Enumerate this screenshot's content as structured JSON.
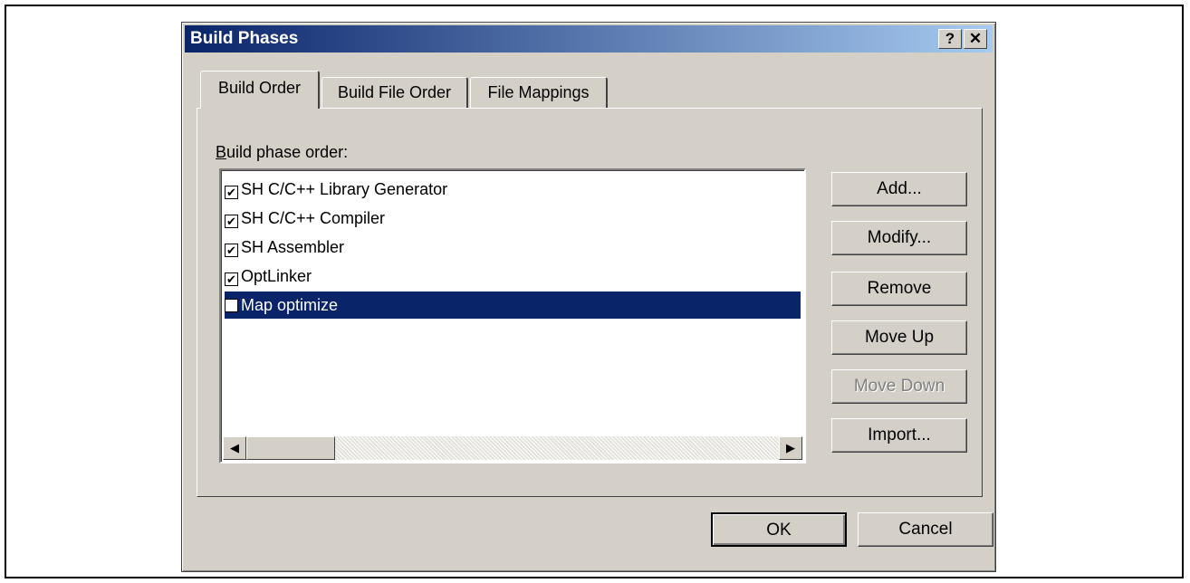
{
  "dialog": {
    "title": "Build Phases",
    "help_button": "?",
    "close_button": "✕"
  },
  "tabs": [
    {
      "label": "Build Order",
      "active": true
    },
    {
      "label": "Build File Order",
      "active": false
    },
    {
      "label": "File Mappings",
      "active": false
    }
  ],
  "panel": {
    "list_label": "Build phase order:",
    "items": [
      {
        "label": "SH C/C++ Library Generator",
        "checked": true
      },
      {
        "label": "SH C/C++ Compiler",
        "checked": true
      },
      {
        "label": "SH Assembler",
        "checked": true
      },
      {
        "label": "OptLinker",
        "checked": true
      },
      {
        "label": "Map optimize",
        "checked": false,
        "selected": true
      }
    ],
    "scroll_left": "◀",
    "scroll_right": "▶"
  },
  "side_buttons": {
    "add": "Add...",
    "modify": "Modify...",
    "remove": "Remove",
    "move_up": "Move Up",
    "move_down": "Move Down",
    "import": "Import..."
  },
  "footer": {
    "ok": "OK",
    "cancel": "Cancel"
  },
  "colors": {
    "titlebar_start": "#0a246a",
    "titlebar_end": "#a6caf0",
    "face": "#d4d0c8",
    "selection": "#0a246a"
  }
}
